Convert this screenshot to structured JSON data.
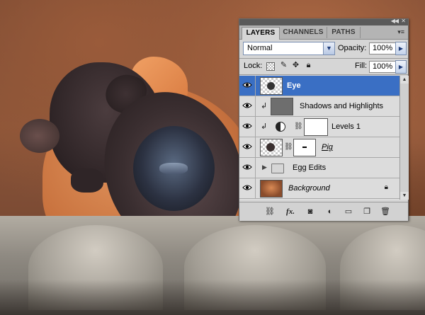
{
  "panel": {
    "tabs": [
      {
        "label": "LAYERS",
        "active": true
      },
      {
        "label": "CHANNELS",
        "active": false
      },
      {
        "label": "PATHS",
        "active": false
      }
    ],
    "blend_mode": "Normal",
    "opacity_label": "Opacity:",
    "opacity_value": "100%",
    "lock_label": "Lock:",
    "fill_label": "Fill:",
    "fill_value": "100%"
  },
  "layers": [
    {
      "name": "Eye",
      "selected": true,
      "visible": true,
      "thumbnail": "eye-pixel-thumb"
    },
    {
      "name": "Shadows and Highlights",
      "selected": false,
      "visible": true,
      "clipped": true,
      "thumbnail": "smart-filter-thumb"
    },
    {
      "name": "Levels 1",
      "selected": false,
      "visible": true,
      "clipped": true,
      "type": "adjustment"
    },
    {
      "name": "Pig",
      "selected": false,
      "visible": true,
      "thumbnail": "pig-pixel-thumb"
    },
    {
      "name": "Egg Edits",
      "selected": false,
      "visible": true,
      "type": "group"
    },
    {
      "name": "Background",
      "selected": false,
      "visible": true,
      "locked": true,
      "thumbnail": "egg-photo-thumb"
    }
  ],
  "bottom_icons": [
    "link-layers-icon",
    "fx-icon",
    "layer-mask-icon",
    "adjustment-layer-icon",
    "new-group-icon",
    "new-layer-icon",
    "trash-icon"
  ],
  "colors": {
    "selection": "#3a6fc4",
    "panel_bg": "#d6d6d6"
  }
}
